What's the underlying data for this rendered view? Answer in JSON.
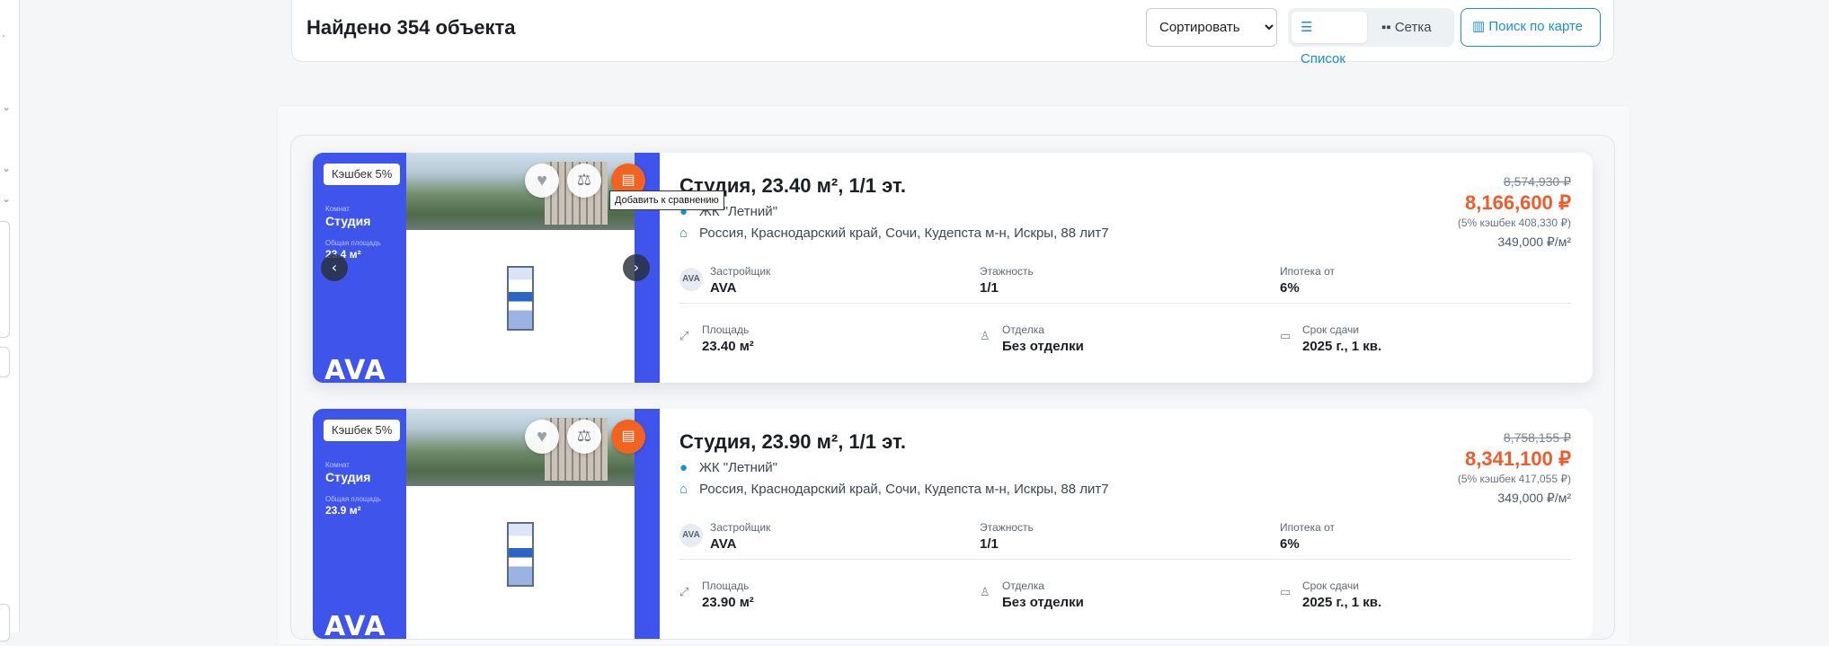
{
  "header": {
    "found": "Найдено 354 объекта",
    "sort": {
      "selected": "Сортировать"
    },
    "view": {
      "list": "Список",
      "grid": "Сетка"
    },
    "map_button": "Поиск по карте"
  },
  "tooltip": "Добавить к сравнению",
  "colors": {
    "accent": "#1a8fcb",
    "price": "#ef5b2b",
    "brand_blue": "#3f54ea",
    "pdf": "#f26322"
  },
  "listings": [
    {
      "cashback_badge": "Кэшбек 5%",
      "promo": {
        "rooms_label": "Комнат",
        "rooms": "Студия",
        "area_label": "Общая площадь",
        "area": "23.4 м²",
        "brand": "AVA"
      },
      "title": "Студия, 23.40 м², 1/1 эт.",
      "complex": "ЖК \"Летний\"",
      "address": "Россия, Краснодарский край, Сочи, Кудепста м-н, Искры, 88 лит7",
      "old_price": "8,574,930 ₽",
      "price": "8,166,600 ₽",
      "cashback_note": "(5% кэшбек 408,330 ₽)",
      "price_per_m": "349,000 ₽/м²",
      "developer_label": "Застройщик",
      "developer": "AVA",
      "developer_avatar": "AVA",
      "floors_label": "Этажность",
      "floors": "1/1",
      "mortgage_label": "Ипотека от",
      "mortgage": "6%",
      "area_label": "Площадь",
      "area": "23.40 м²",
      "finish_label": "Отделка",
      "finish": "Без отделки",
      "deadline_label": "Срок сдачи",
      "deadline": "2025 г., 1 кв."
    },
    {
      "cashback_badge": "Кэшбек 5%",
      "promo": {
        "rooms_label": "Комнат",
        "rooms": "Студия",
        "area_label": "Общая площадь",
        "area": "23.9 м²",
        "brand": "AVA"
      },
      "title": "Студия, 23.90 м², 1/1 эт.",
      "complex": "ЖК \"Летний\"",
      "address": "Россия, Краснодарский край, Сочи, Кудепста м-н, Искры, 88 лит7",
      "old_price": "8,758,155 ₽",
      "price": "8,341,100 ₽",
      "cashback_note": "(5% кэшбек 417,055 ₽)",
      "price_per_m": "349,000 ₽/м²",
      "developer_label": "Застройщик",
      "developer": "AVA",
      "developer_avatar": "AVA",
      "floors_label": "Этажность",
      "floors": "1/1",
      "mortgage_label": "Ипотека от",
      "mortgage": "6%",
      "area_label": "Площадь",
      "area": "23.90 м²",
      "finish_label": "Отделка",
      "finish": "Без отделки",
      "deadline_label": "Срок сдачи",
      "deadline": "2025 г., 1 кв."
    }
  ]
}
